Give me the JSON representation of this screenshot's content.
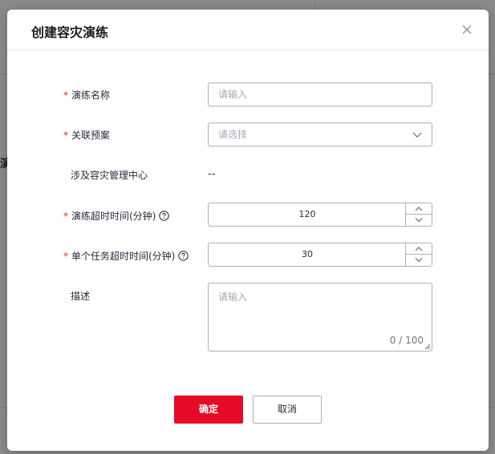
{
  "dialog": {
    "title": "创建容灾演练",
    "close_icon": "close-icon"
  },
  "form": {
    "drill_name": {
      "label": "演练名称",
      "required": "*",
      "placeholder": "请输入"
    },
    "plan": {
      "label": "关联预案",
      "required": "*",
      "placeholder": "请选择"
    },
    "center": {
      "label": "涉及容灾管理中心",
      "value": "--"
    },
    "drill_timeout": {
      "label": "演练超时时间(分钟)",
      "required": "*",
      "value": "120"
    },
    "task_timeout": {
      "label": "单个任务超时时间(分钟)",
      "required": "*",
      "value": "30"
    },
    "description": {
      "label": "描述",
      "placeholder": "请输入",
      "counter": "0 / 100"
    }
  },
  "footer": {
    "confirm_label": "确定",
    "cancel_label": "取消"
  },
  "background": {
    "partial_text": "演"
  },
  "colors": {
    "primary": "#e60a27",
    "required_mark": "#e0262d"
  }
}
